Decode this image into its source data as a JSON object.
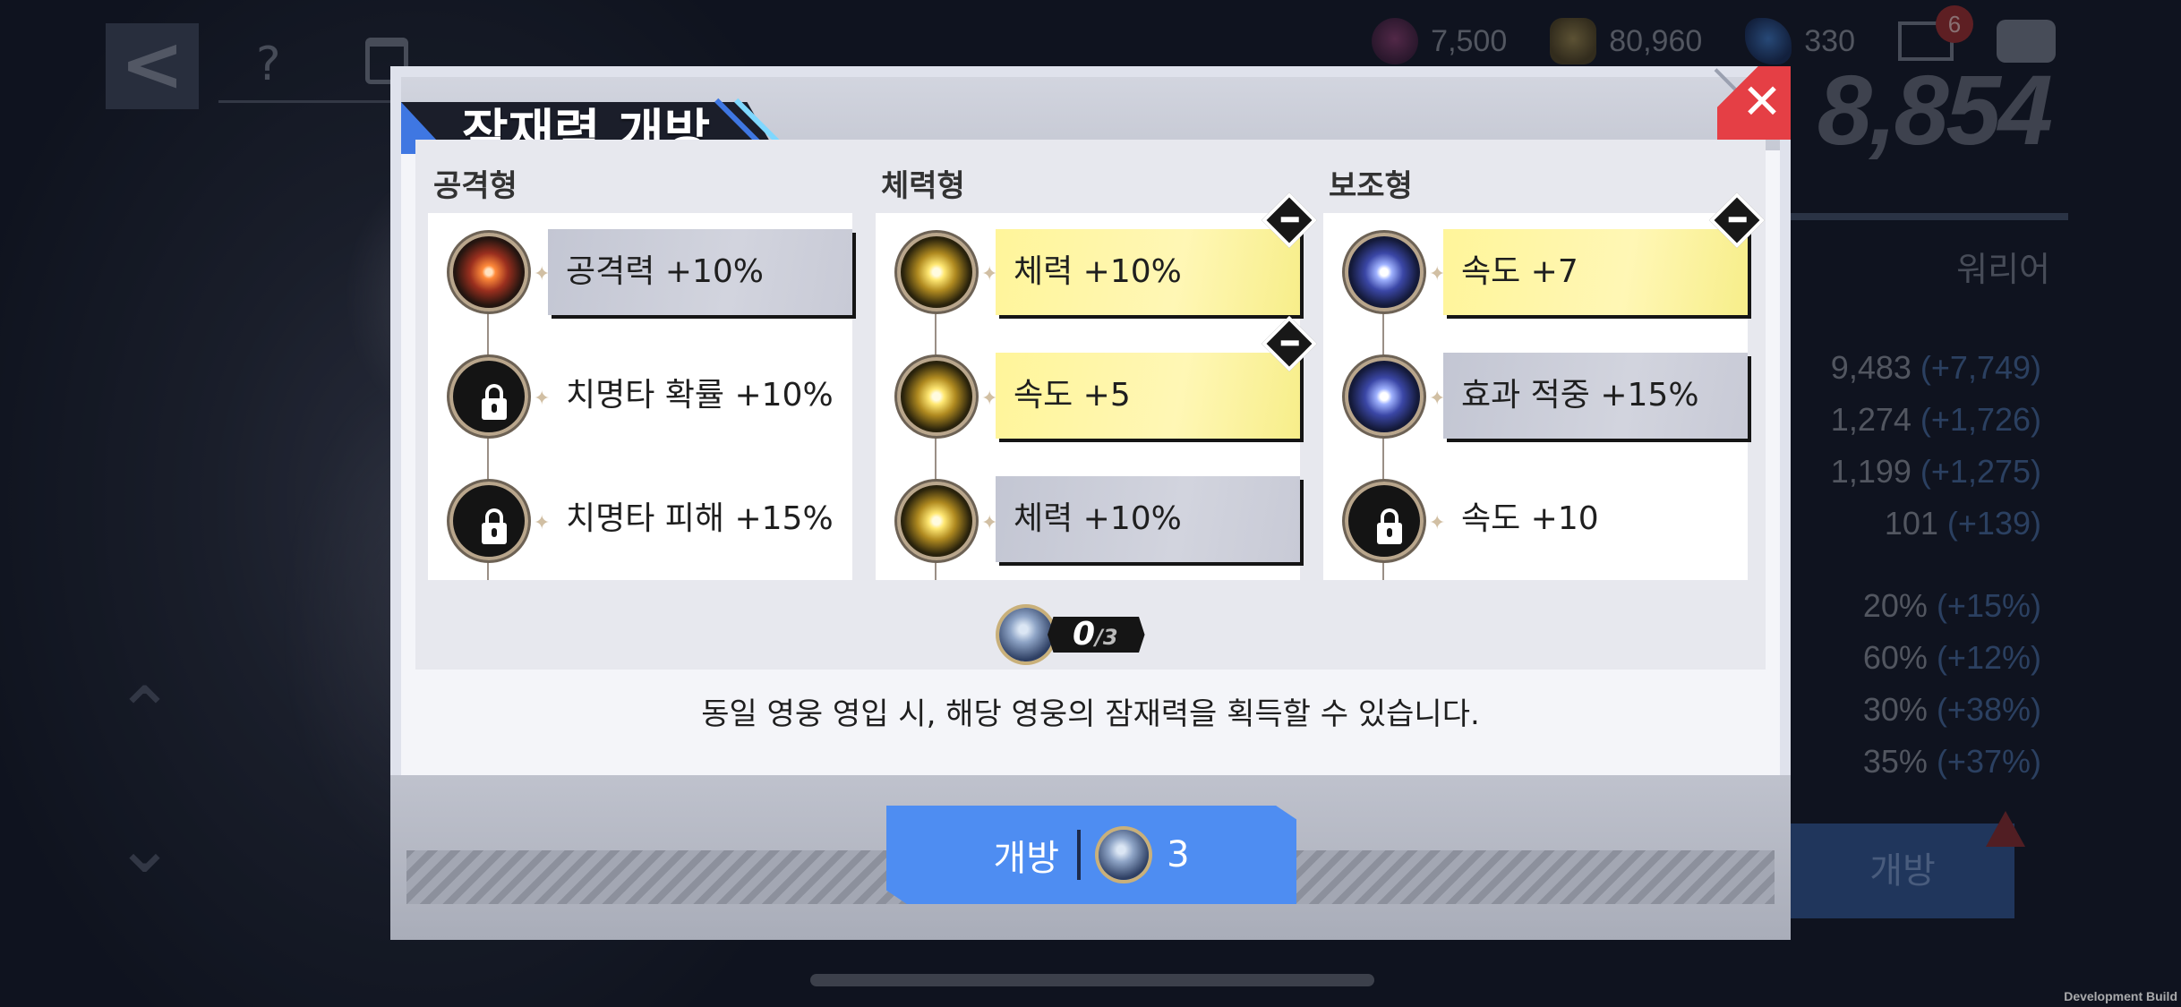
{
  "modal": {
    "title": "잠재력 개방",
    "columns": [
      {
        "title": "공격형",
        "type": "attack",
        "nodes": [
          {
            "label": "공격력 +10%",
            "state": "unlocked",
            "style": "grey"
          },
          {
            "label": "치명타 확률 +10%",
            "state": "locked",
            "style": "plain"
          },
          {
            "label": "치명타 피해 +15%",
            "state": "locked",
            "style": "plain"
          }
        ]
      },
      {
        "title": "체력형",
        "type": "stamina",
        "nodes": [
          {
            "label": "체력 +10%",
            "state": "selected",
            "style": "yellow"
          },
          {
            "label": "속도 +5",
            "state": "selected",
            "style": "yellow"
          },
          {
            "label": "체력 +10%",
            "state": "unlocked",
            "style": "grey"
          }
        ]
      },
      {
        "title": "보조형",
        "type": "support",
        "nodes": [
          {
            "label": "속도 +7",
            "state": "selected",
            "style": "yellow"
          },
          {
            "label": "효과 적중 +15%",
            "state": "unlocked",
            "style": "grey"
          },
          {
            "label": "속도 +10",
            "state": "locked",
            "style": "plain"
          }
        ]
      }
    ],
    "counter": {
      "current": "0",
      "max": "/3"
    },
    "info": "동일 영웅 영입 시, 해당 영웅의 잠재력을 획득할 수 있습니다.",
    "open_button": {
      "label": "개방",
      "cost": "3"
    }
  },
  "background": {
    "currency": [
      {
        "icon": "crest-icon",
        "value": "7,500"
      },
      {
        "icon": "gold-icon",
        "value": "80,960"
      },
      {
        "icon": "crystal-icon",
        "value": "330"
      }
    ],
    "mail_badge": "6",
    "help_glyph": "?",
    "power": "8,854",
    "class_label": "워리어",
    "stats": [
      {
        "value": "9,483",
        "bonus": "(+7,749)"
      },
      {
        "value": "1,274",
        "bonus": "(+1,726)"
      },
      {
        "value": "1,199",
        "bonus": "(+1,275)"
      },
      {
        "value": "101",
        "bonus": "(+139)"
      },
      {
        "value": "20%",
        "bonus": "(+15%)"
      },
      {
        "value": "60%",
        "bonus": "(+12%)"
      },
      {
        "value": "30%",
        "bonus": "(+38%)"
      },
      {
        "value": "35%",
        "bonus": "(+37%)"
      }
    ],
    "open_button_bg": "개방",
    "dev_build": "Development Build"
  },
  "colors": {
    "accent_blue": "#4e8df2",
    "close_red": "#e53f45",
    "selected_yellow": "#fff59a"
  }
}
